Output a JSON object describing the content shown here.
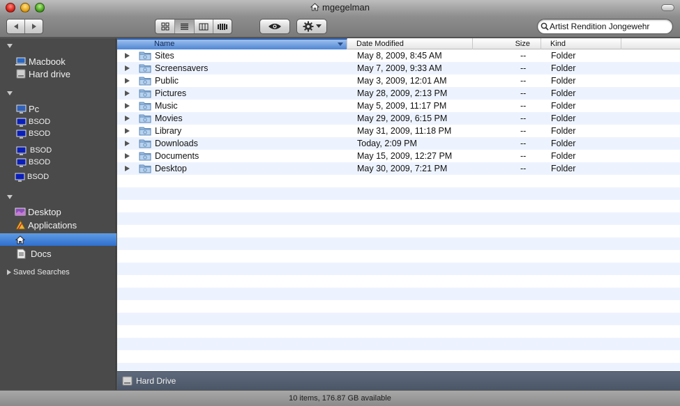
{
  "window": {
    "title": "mgegelman",
    "title_icon": "home-icon"
  },
  "toolbar": {
    "back_icon": "back-arrow-icon",
    "forward_icon": "forward-arrow-icon",
    "views": [
      "icon-view-icon",
      "list-view-icon",
      "column-view-icon",
      "coverflow-view-icon"
    ],
    "active_view": "list-view-icon",
    "quicklook_icon": "eye-icon",
    "action_icon": "gear-icon",
    "search": {
      "value": "Artist Rendition Jongewehr",
      "icon": "magnifier-icon"
    }
  },
  "sidebar": {
    "devices": [
      {
        "label": "Macbook",
        "icon": "laptop-icon"
      },
      {
        "label": "Hard drive",
        "icon": "hard-drive-icon"
      }
    ],
    "shared": [
      {
        "label": "Pc",
        "icon": "monitor-icon"
      },
      {
        "label": "BSOD",
        "icon": "bsod-monitor-icon"
      },
      {
        "label": "BSOD",
        "icon": "bsod-monitor-icon"
      },
      {
        "label": "BSOD",
        "icon": "bsod-monitor-icon"
      },
      {
        "label": "BSOD",
        "icon": "bsod-monitor-icon"
      },
      {
        "label": "BSOD",
        "icon": "bsod-monitor-icon"
      }
    ],
    "places": [
      {
        "label": "Desktop",
        "icon": "desktop-icon"
      },
      {
        "label": "Applications",
        "icon": "applications-icon"
      },
      {
        "label": "",
        "icon": "home-icon",
        "selected": true
      },
      {
        "label": "Docs",
        "icon": "document-icon"
      }
    ],
    "saved_searches_label": "Saved Searches"
  },
  "columns": {
    "name": "Name",
    "date": "Date Modified",
    "size": "Size",
    "kind": "Kind"
  },
  "files": [
    {
      "name": "Sites",
      "date": "May 8, 2009, 8:45 AM",
      "size": "--",
      "kind": "Folder",
      "icon": "sites-folder-icon"
    },
    {
      "name": "Screensavers",
      "date": "May 7, 2009, 9:33 AM",
      "size": "--",
      "kind": "Folder",
      "icon": "folder-icon"
    },
    {
      "name": "Public",
      "date": "May 3, 2009, 12:01 AM",
      "size": "--",
      "kind": "Folder",
      "icon": "public-folder-icon"
    },
    {
      "name": "Pictures",
      "date": "May 28, 2009, 2:13 PM",
      "size": "--",
      "kind": "Folder",
      "icon": "pictures-folder-icon"
    },
    {
      "name": "Music",
      "date": "May 5, 2009, 11:17 PM",
      "size": "--",
      "kind": "Folder",
      "icon": "music-folder-icon"
    },
    {
      "name": "Movies",
      "date": "May 29, 2009, 6:15 PM",
      "size": "--",
      "kind": "Folder",
      "icon": "movies-folder-icon"
    },
    {
      "name": "Library",
      "date": "May 31, 2009, 11:18 PM",
      "size": "--",
      "kind": "Folder",
      "icon": "library-folder-icon"
    },
    {
      "name": "Downloads",
      "date": "Today, 2:09 PM",
      "size": "--",
      "kind": "Folder",
      "icon": "downloads-folder-icon"
    },
    {
      "name": "Documents",
      "date": "May 15, 2009, 12:27 PM",
      "size": "--",
      "kind": "Folder",
      "icon": "documents-folder-icon"
    },
    {
      "name": "Desktop",
      "date": "May 30, 2009, 7:21 PM",
      "size": "--",
      "kind": "Folder",
      "icon": "desktop-folder-icon"
    }
  ],
  "pathbar": {
    "label": "Hard Drive",
    "icon": "hard-drive-icon"
  },
  "status": {
    "text": "10 items, 176.87 GB available"
  },
  "colors": {
    "selection": "#3d7fd8",
    "sidebar_bg": "#4a4a4a",
    "row_alt": "#edf3fe",
    "pathbar_bg": "#505b6c"
  }
}
